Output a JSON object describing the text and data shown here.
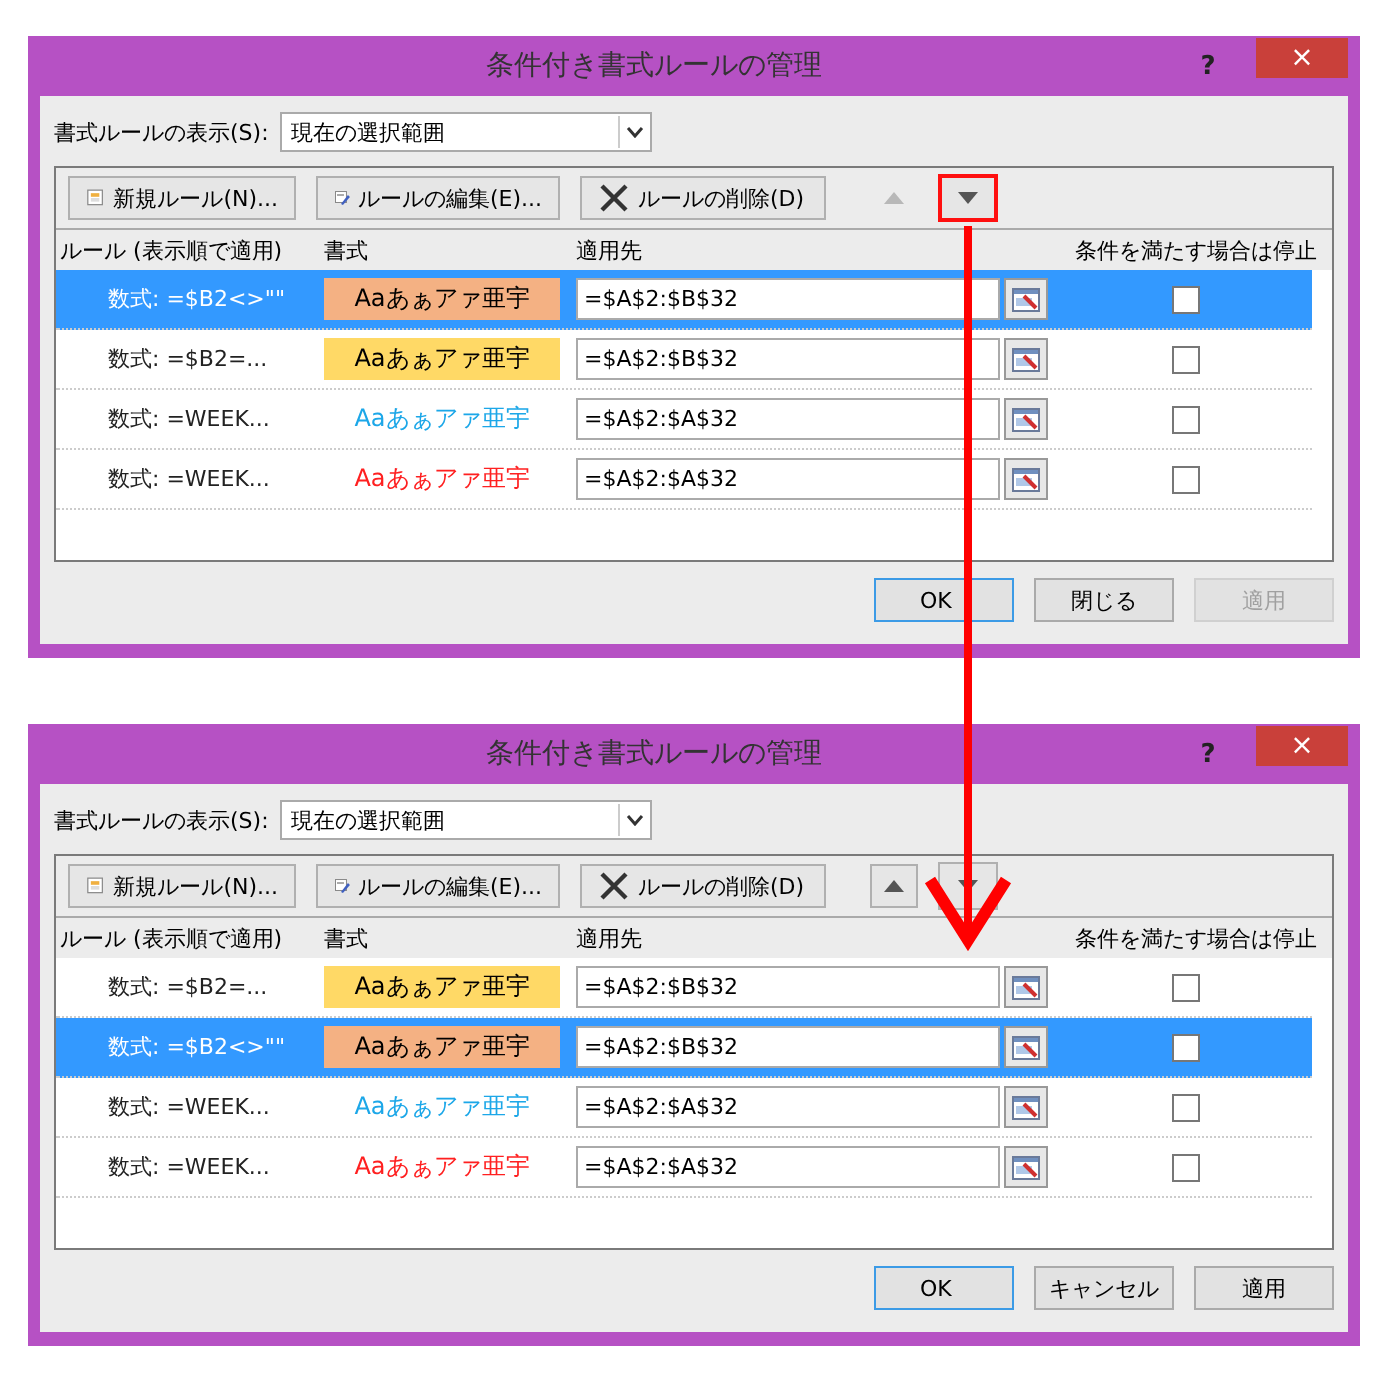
{
  "dialogs": [
    {
      "title": "条件付き書式ルールの管理",
      "help": "?",
      "close": "×",
      "filter_label": "書式ルールの表示(S):",
      "filter_value": "現在の選択範囲",
      "toolbar": [
        {
          "kind": "new",
          "label": "新規ルール(N)..."
        },
        {
          "kind": "edit",
          "label": "ルールの編集(E)..."
        },
        {
          "kind": "delete",
          "label": "ルールの削除(D)"
        }
      ],
      "move_up": {
        "disabled": true
      },
      "move_down": {
        "disabled": false,
        "highlighted": true
      },
      "columns": [
        "ルール (表示順で適用)",
        "書式",
        "適用先",
        "条件を満たす場合は停止"
      ],
      "rows": [
        {
          "rule": "数式: =$B2<>\"\"",
          "format": {
            "text": "Aaあぁアァ亜宇",
            "kind": "fill",
            "color": "#f4b183"
          },
          "applies_to": "=$A$2:$B$32",
          "stop": false,
          "selected": true
        },
        {
          "rule": "数式: =$B2=...",
          "format": {
            "text": "Aaあぁアァ亜宇",
            "kind": "fill",
            "color": "#ffd966"
          },
          "applies_to": "=$A$2:$B$32",
          "stop": false,
          "selected": false
        },
        {
          "rule": "数式: =WEEK...",
          "format": {
            "text": "Aaあぁアァ亜宇",
            "kind": "text",
            "color": "#1ca7e8"
          },
          "applies_to": "=$A$2:$A$32",
          "stop": false,
          "selected": false
        },
        {
          "rule": "数式: =WEEK...",
          "format": {
            "text": "Aaあぁアァ亜宇",
            "kind": "text",
            "color": "#ff2020"
          },
          "applies_to": "=$A$2:$A$32",
          "stop": false,
          "selected": false
        }
      ],
      "buttons": [
        {
          "label": "OK",
          "disabled": false,
          "default": true
        },
        {
          "label": "閉じる",
          "disabled": false,
          "default": false
        },
        {
          "label": "適用",
          "disabled": true,
          "default": false
        }
      ]
    },
    {
      "title": "条件付き書式ルールの管理",
      "help": "?",
      "close": "×",
      "filter_label": "書式ルールの表示(S):",
      "filter_value": "現在の選択範囲",
      "toolbar": [
        {
          "kind": "new",
          "label": "新規ルール(N)..."
        },
        {
          "kind": "edit",
          "label": "ルールの編集(E)..."
        },
        {
          "kind": "delete",
          "label": "ルールの削除(D)"
        }
      ],
      "move_up": {
        "disabled": false
      },
      "move_down": {
        "disabled": false,
        "highlighted": false
      },
      "columns": [
        "ルール (表示順で適用)",
        "書式",
        "適用先",
        "条件を満たす場合は停止"
      ],
      "rows": [
        {
          "rule": "数式: =$B2=...",
          "format": {
            "text": "Aaあぁアァ亜宇",
            "kind": "fill",
            "color": "#ffd966"
          },
          "applies_to": "=$A$2:$B$32",
          "stop": false,
          "selected": false
        },
        {
          "rule": "数式: =$B2<>\"\"",
          "format": {
            "text": "Aaあぁアァ亜宇",
            "kind": "fill",
            "color": "#f4b183"
          },
          "applies_to": "=$A$2:$B$32",
          "stop": false,
          "selected": true
        },
        {
          "rule": "数式: =WEEK...",
          "format": {
            "text": "Aaあぁアァ亜宇",
            "kind": "text",
            "color": "#1ca7e8"
          },
          "applies_to": "=$A$2:$A$32",
          "stop": false,
          "selected": false
        },
        {
          "rule": "数式: =WEEK...",
          "format": {
            "text": "Aaあぁアァ亜宇",
            "kind": "text",
            "color": "#ff2020"
          },
          "applies_to": "=$A$2:$A$32",
          "stop": false,
          "selected": false
        }
      ],
      "buttons": [
        {
          "label": "OK",
          "disabled": false,
          "default": true
        },
        {
          "label": "キャンセル",
          "disabled": false,
          "default": false
        },
        {
          "label": "適用",
          "disabled": false,
          "default": false
        }
      ]
    }
  ],
  "arrow": {
    "shown": true
  }
}
